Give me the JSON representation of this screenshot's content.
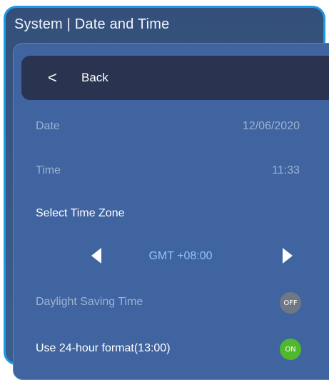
{
  "header": {
    "title": "System | Date and Time"
  },
  "back": {
    "label": "Back",
    "icon": "chevron-left-icon"
  },
  "date": {
    "label": "Date",
    "value": "12/06/2020"
  },
  "time": {
    "label": "Time",
    "value": "11:33"
  },
  "timezone": {
    "heading": "Select Time Zone",
    "value": "GMT +08:00"
  },
  "daylight_saving": {
    "label": "Daylight Saving Time",
    "state": "OFF"
  },
  "hour_format": {
    "label": "Use 24-hour format(13:00)",
    "state": "ON"
  },
  "colors": {
    "frame_border": "#1a9be6",
    "on": "#4fb82c",
    "off": "#707784",
    "accent_text": "#8ec3ff"
  }
}
